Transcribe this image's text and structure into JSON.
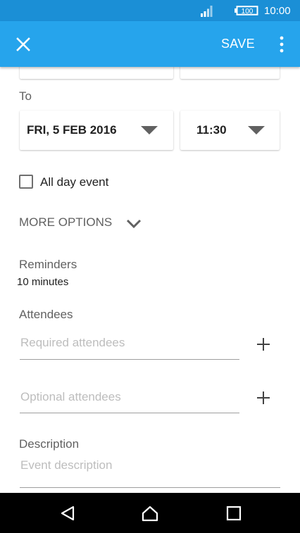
{
  "status_bar": {
    "battery_level": "100",
    "time": "10:00"
  },
  "app_bar": {
    "close_icon": "close-icon",
    "save_label": "SAVE",
    "overflow_icon": "more-vert-icon"
  },
  "form": {
    "to_label": "To",
    "to_date": "FRI, 5 FEB 2016",
    "to_time": "11:30",
    "all_day_label": "All day event",
    "all_day_checked": false,
    "more_options_label": "MORE OPTIONS",
    "reminders_label": "Reminders",
    "reminders_value": "10 minutes",
    "attendees_label": "Attendees",
    "required_attendees_placeholder": "Required attendees",
    "optional_attendees_placeholder": "Optional attendees",
    "description_label": "Description",
    "description_placeholder": "Event description"
  },
  "colors": {
    "status_bar": "#1b8fd6",
    "app_bar": "#26a4ec",
    "nav_bar": "#000000"
  }
}
